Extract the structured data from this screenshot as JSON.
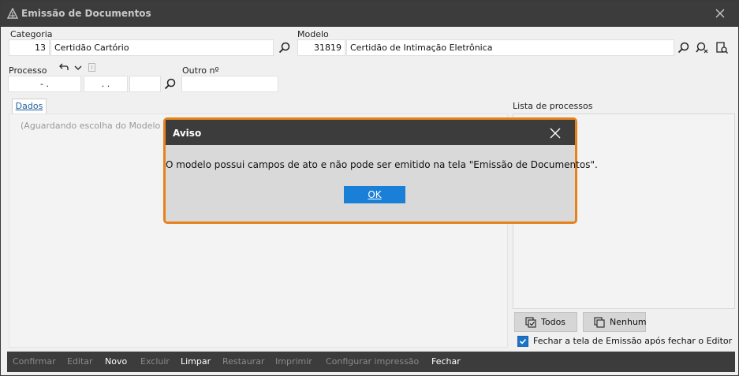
{
  "window": {
    "title": "Emissão de Documentos"
  },
  "categoria": {
    "label": "Categoria",
    "code": "13",
    "name": "Certidão Cartório"
  },
  "modelo": {
    "label": "Modelo",
    "code": "31819",
    "name": "Certidão de Intimação Eletrônica"
  },
  "processo": {
    "label": "Processo",
    "part1": "-  .",
    "part2": ".  .",
    "part3": ""
  },
  "outro": {
    "label": "Outro nº",
    "value": ""
  },
  "tabs": {
    "dados": "Dados"
  },
  "panel": {
    "hint": "(Aguardando escolha do Modelo e Processo)"
  },
  "lista": {
    "label": "Lista de processos"
  },
  "buttons": {
    "todos": "Todos",
    "nenhum": "Nenhum"
  },
  "checkbox": {
    "label": "Fechar a tela de Emissão após fechar o Editor",
    "checked": true
  },
  "actions": [
    {
      "label": "Confirmar",
      "enabled": false
    },
    {
      "label": "Editar",
      "enabled": false
    },
    {
      "label": "Novo",
      "enabled": true
    },
    {
      "label": "Excluir",
      "enabled": false
    },
    {
      "label": "Limpar",
      "enabled": true
    },
    {
      "label": "Restaurar",
      "enabled": false
    },
    {
      "label": "Imprimir",
      "enabled": false
    },
    {
      "label": "Configurar impressão",
      "enabled": false
    },
    {
      "label": "Fechar",
      "enabled": true
    }
  ],
  "dialog": {
    "title": "Aviso",
    "message": "O modelo possui campos de ato e não pode ser emitido na tela \"Emissão de Documentos\".",
    "ok": "OK"
  },
  "colors": {
    "accent": "#1a7fd6",
    "highlight": "#e5821c",
    "titlebar": "#3c3c3c"
  }
}
